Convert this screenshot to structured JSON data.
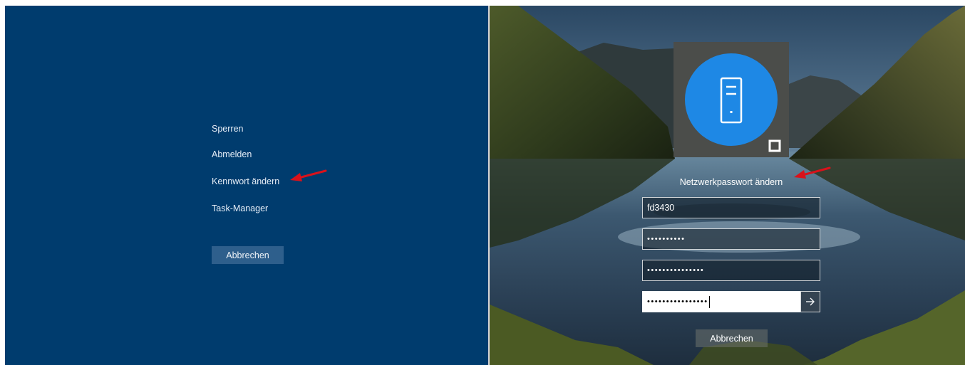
{
  "security_options": {
    "lock": "Sperren",
    "sign_out": "Abmelden",
    "change_password": "Kennwort ändern",
    "task_manager": "Task-Manager",
    "cancel": "Abbrechen"
  },
  "change_password_screen": {
    "title": "Netzwerkpasswort ändern",
    "username_value": "fd3430",
    "old_password_mask": "••••••••••",
    "new_password_mask": "•••••••••••••••",
    "confirm_password_mask": "••••••••••••••••",
    "submit_icon": "arrow-right-icon",
    "avatar_icon": "server-device-icon",
    "cancel": "Abbrechen"
  },
  "colors": {
    "left_background": "#003c6e",
    "avatar_circle": "#1e88e5",
    "annotation_arrow": "#d9121b"
  }
}
